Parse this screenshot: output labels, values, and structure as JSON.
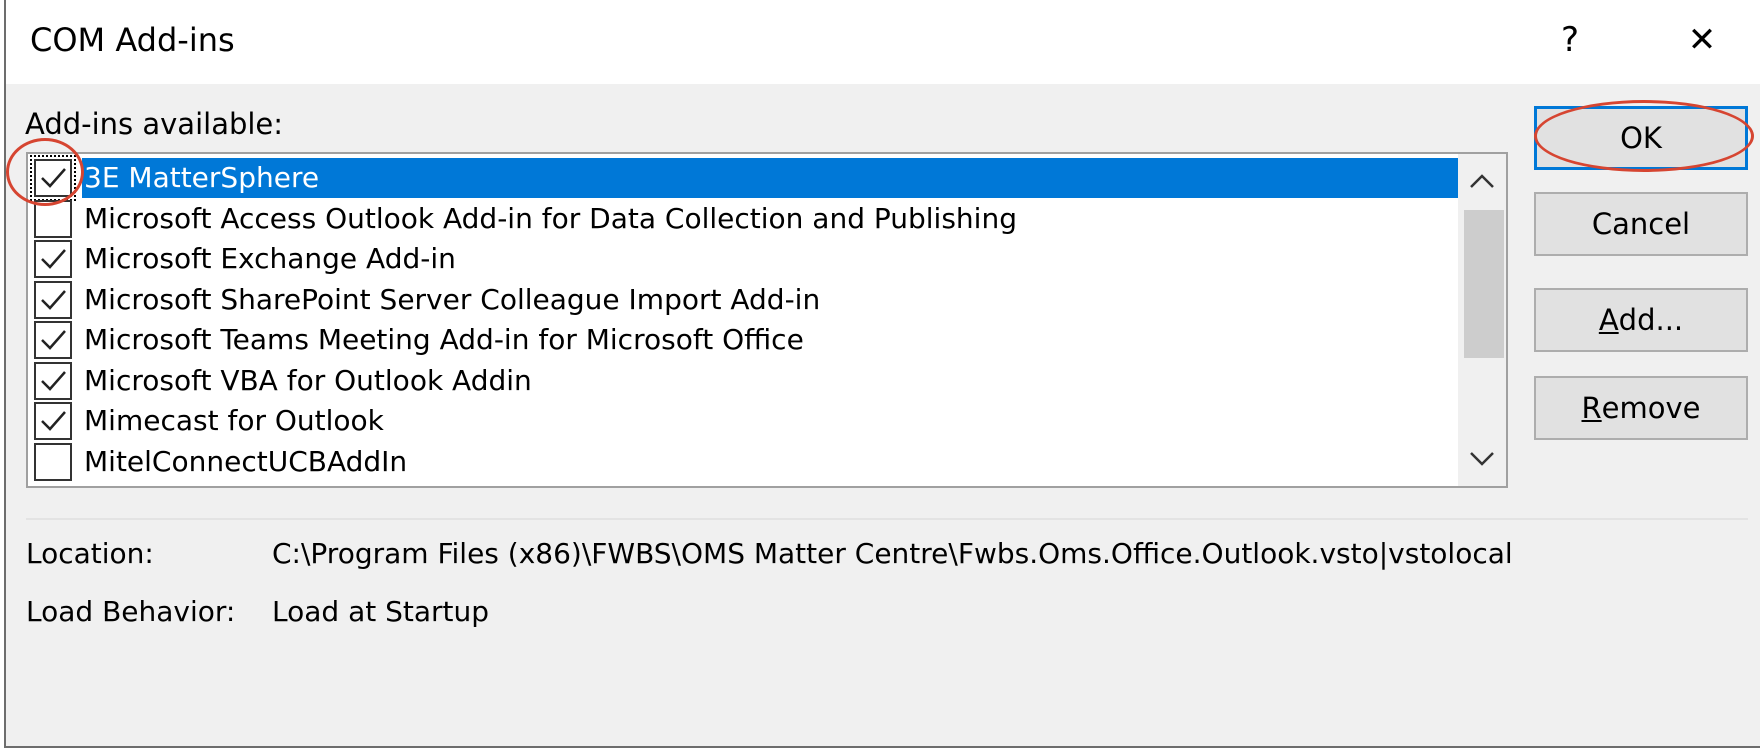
{
  "window": {
    "title": "COM Add-ins",
    "help_glyph": "?",
    "close_glyph": "✕"
  },
  "addins_label": "Add-ins available:",
  "addins": [
    {
      "label": "3E MatterSphere",
      "checked": true,
      "selected": true
    },
    {
      "label": "Microsoft Access Outlook Add-in for Data Collection and Publishing",
      "checked": false,
      "selected": false
    },
    {
      "label": "Microsoft Exchange Add-in",
      "checked": true,
      "selected": false
    },
    {
      "label": "Microsoft SharePoint Server Colleague Import Add-in",
      "checked": true,
      "selected": false
    },
    {
      "label": "Microsoft Teams Meeting Add-in for Microsoft Office",
      "checked": true,
      "selected": false
    },
    {
      "label": "Microsoft VBA for Outlook Addin",
      "checked": true,
      "selected": false
    },
    {
      "label": "Mimecast for Outlook",
      "checked": true,
      "selected": false
    },
    {
      "label": "MitelConnectUCBAddIn",
      "checked": false,
      "selected": false
    }
  ],
  "buttons": {
    "ok": "OK",
    "cancel": "Cancel",
    "add": "Add...",
    "remove": "Remove"
  },
  "details": {
    "location_label": "Location:",
    "location_value": "C:\\Program Files (x86)\\FWBS\\OMS Matter Centre\\Fwbs.Oms.Office.Outlook.vsto|vstolocal",
    "load_behavior_label": "Load Behavior:",
    "load_behavior_value": "Load at Startup"
  },
  "colors": {
    "selection": "#0078d7",
    "annotation": "#d64531"
  }
}
